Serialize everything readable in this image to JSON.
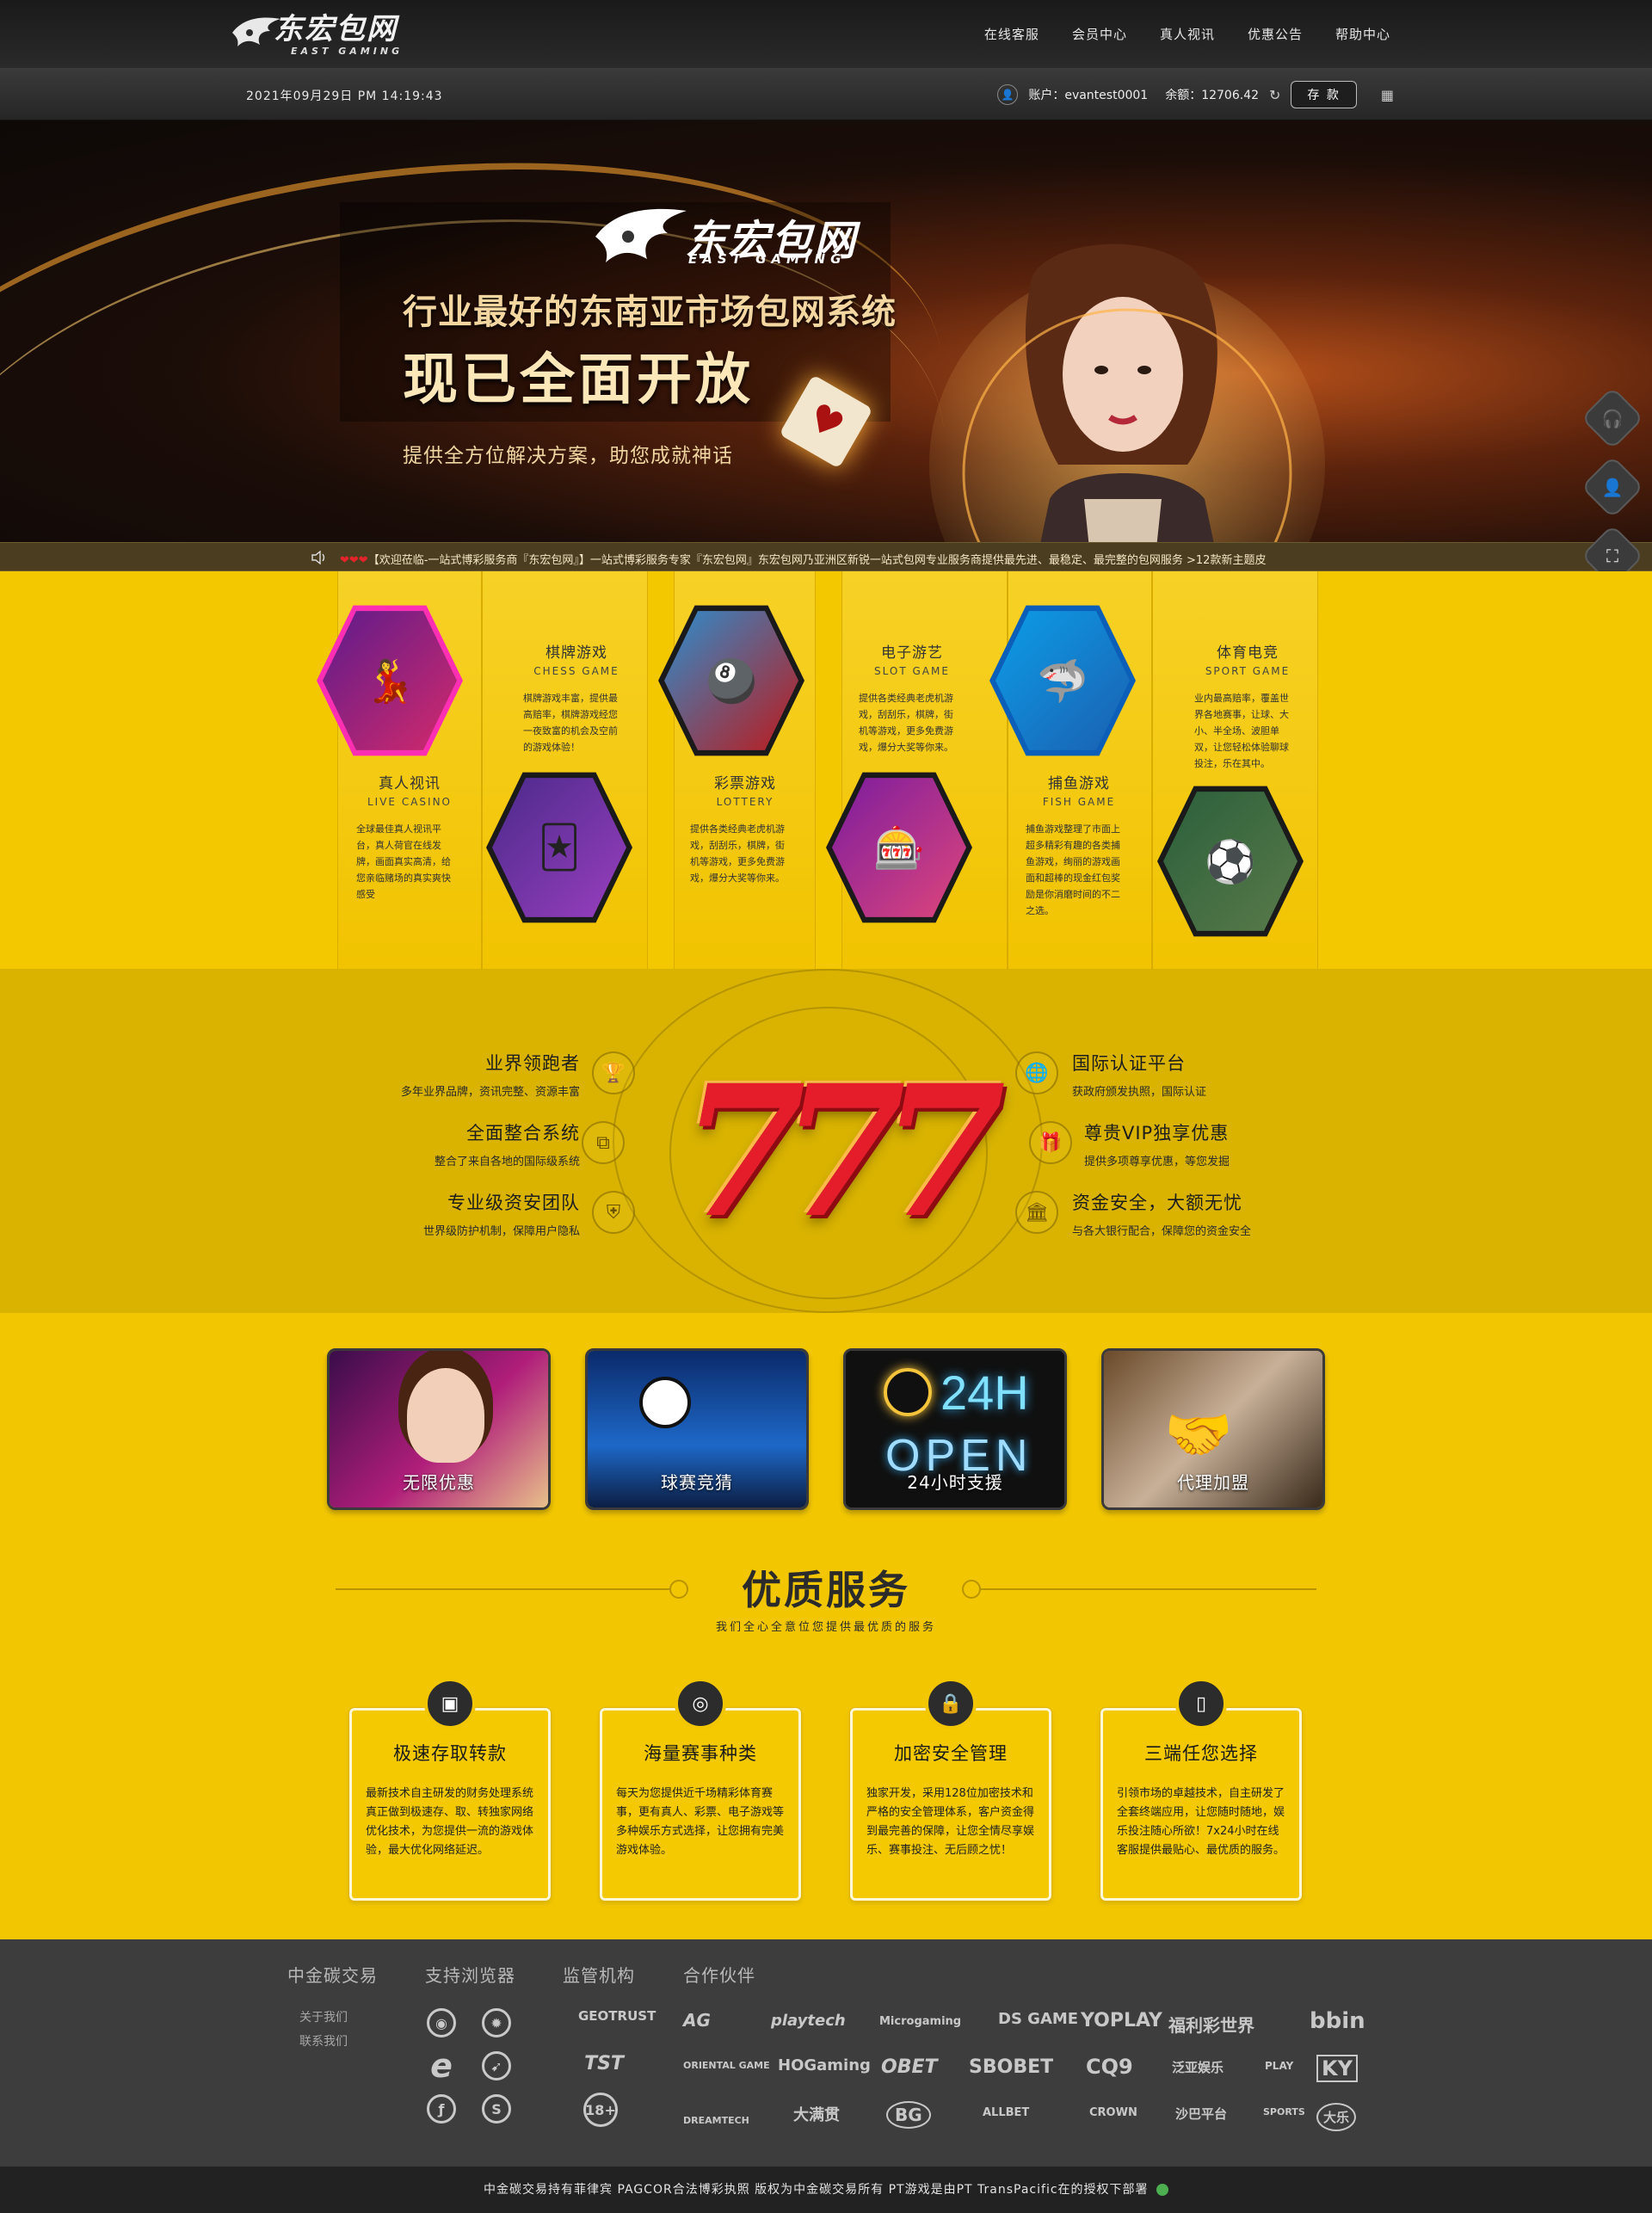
{
  "header": {
    "logo_cn": "东宏包网",
    "logo_en": "EAST GAMING",
    "nav": [
      "在线客服",
      "会员中心",
      "真人视讯",
      "优惠公告",
      "帮助中心"
    ]
  },
  "subbar": {
    "datetime": "2021年09月29日 PM 14:19:43",
    "account": "账户：evantest0001",
    "balance": "余额：12706.42",
    "deposit": "存 款"
  },
  "hero": {
    "logo_cn": "东宏包网",
    "logo_en": "EAST GAMING",
    "line1": "行业最好的东南亚市场包网系统",
    "line2": "现已全面开放",
    "line3": "提供全方位解决方案，助您成就神话"
  },
  "ticker": {
    "hearts": "❤❤❤",
    "text": "【欢迎莅临-一站式博彩服务商『东宏包网』】一站式博彩服务专家『东宏包网』东宏包网乃亚洲区新锐一站式包网专业服务商提供最先进、最稳定、最完整的包网服务 >12款新主题皮"
  },
  "games": [
    {
      "cn": "真人视讯",
      "en": "LIVE CASINO",
      "desc": "全球最佳真人视讯平台，真人荷官在线发牌，画面真实高清，给您亲临赌场的真实爽快感受",
      "icon": "dealer-icon"
    },
    {
      "cn": "棋牌游戏",
      "en": "CHESS GAME",
      "desc": "棋牌游戏丰富，提供最高赔率，棋牌游戏经您一夜致富的机会及空前的游戏体验！",
      "icon": "card-girl-icon"
    },
    {
      "cn": "彩票游戏",
      "en": "LOTTERY",
      "desc": "提供各类经典老虎机游戏，刮刮乐，棋牌，街机等游戏，更多免费游戏，爆分大奖等你来。",
      "icon": "lottery-ball-icon"
    },
    {
      "cn": "电子游艺",
      "en": "SLOT GAME",
      "desc": "提供各类经典老虎机游戏，刮刮乐，棋牌，街机等游戏，更多免费游戏，爆分大奖等你来。",
      "icon": "slot-girl-icon"
    },
    {
      "cn": "捕鱼游戏",
      "en": "FISH GAME",
      "desc": "捕鱼游戏整理了市面上超多精彩有趣的各类捕鱼游戏，绚丽的游戏画面和超棒的现金红包奖励是你消磨时间的不二之选。",
      "icon": "shark-icon"
    },
    {
      "cn": "体育电竞",
      "en": "SPORT GAME",
      "desc": "业内最高赔率，覆盖世界各地赛事，让球、大小、半全场、波胆单双，让您轻松体验聊球投注，乐在其中。",
      "icon": "footballer-icon"
    }
  ],
  "features": {
    "left": [
      {
        "title": "业界领跑者",
        "sub": "多年业界品牌，资讯完整、资源丰富",
        "icon": "trophy-icon"
      },
      {
        "title": "全面整合系统",
        "sub": "整合了来自各地的国际级系统",
        "icon": "network-icon"
      },
      {
        "title": "专业级资安团队",
        "sub": "世界级防护机制，保障用户隐私",
        "icon": "shield-icon"
      }
    ],
    "right": [
      {
        "title": "国际认证平台",
        "sub": "获政府颁发执照，国际认证",
        "icon": "globe-icon"
      },
      {
        "title": "尊贵VIP独享优惠",
        "sub": "提供多项尊享优惠，等您发掘",
        "icon": "gift-icon"
      },
      {
        "title": "资金安全，大额无忧",
        "sub": "与各大银行配合，保障您的资金安全",
        "icon": "bank-icon"
      }
    ],
    "center": "777"
  },
  "promos": [
    {
      "label": "无限优惠",
      "icon": "promo-girl-icon"
    },
    {
      "label": "球赛竞猜",
      "icon": "football-icon"
    },
    {
      "label": "24小时支援",
      "icon": "24h-open-icon",
      "neon1": "24H",
      "neon2": "OPEN"
    },
    {
      "label": "代理加盟",
      "icon": "handshake-icon"
    }
  ],
  "services": {
    "title": "优质服务",
    "subtitle": "我们全心全意位您提供最优质的服务",
    "cards": [
      {
        "title": "极速存取转款",
        "text": "最新技术自主研发的财务处理系统真正做到极速存、取、转独家网络优化技术，为您提供一流的游戏体验，最大优化网络延迟。",
        "icon": "wallet-icon"
      },
      {
        "title": "海量赛事种类",
        "text": "每天为您提供近千场精彩体育赛事，更有真人、彩票、电子游戏等多种娱乐方式选择，让您拥有完美游戏体验。",
        "icon": "basketball-icon"
      },
      {
        "title": "加密安全管理",
        "text": "独家开发，采用128位加密技术和严格的安全管理体系，客户资金得到最完善的保障，让您全情尽享娱乐、赛事投注、无后顾之忧！",
        "icon": "lock-icon"
      },
      {
        "title": "三端任您选择",
        "text": "引领市场的卓越技术，自主研发了全套终端应用，让您随时随地，娱乐投注随心所欲！7x24小时在线客服提供最贴心、最优质的服务。",
        "icon": "mobile-icon"
      }
    ]
  },
  "footer": {
    "headings": [
      "中金碳交易",
      "支持浏览器",
      "监管机构",
      "合作伙伴"
    ],
    "links": [
      "关于我们",
      "联系我们"
    ],
    "browsers": [
      "chrome-icon",
      "firefox-icon",
      "ie-icon",
      "safari-icon",
      "flash-icon",
      "sogou-icon"
    ],
    "regulators": [
      "GEOTRUST",
      "TST",
      "18+"
    ],
    "partners_row1": [
      "AG",
      "playtech",
      "Microgaming",
      "DS GAME",
      "YOPLAY",
      "福利彩世界",
      "bbin"
    ],
    "partners_row2": [
      "ORIENTAL GAME",
      "HOGaming",
      "OBET",
      "SBOBET",
      "CQ9",
      "泛亚娱乐",
      "PLAY",
      "KY"
    ],
    "partners_row3": [
      "DREAMTECH",
      "大满贯",
      "BG",
      "ALLBET",
      "CROWN",
      "沙巴平台",
      "SPORTS",
      "大乐"
    ],
    "copyright": "中金碳交易持有菲律宾 PAGCOR合法博彩执照 版权为中金碳交易所有 PT游戏是由PT TransPacific在的授权下部署"
  },
  "colors": {
    "accent": "#f3c800",
    "dark": "#2e2e2e",
    "feature_bg": "#d9b300"
  }
}
